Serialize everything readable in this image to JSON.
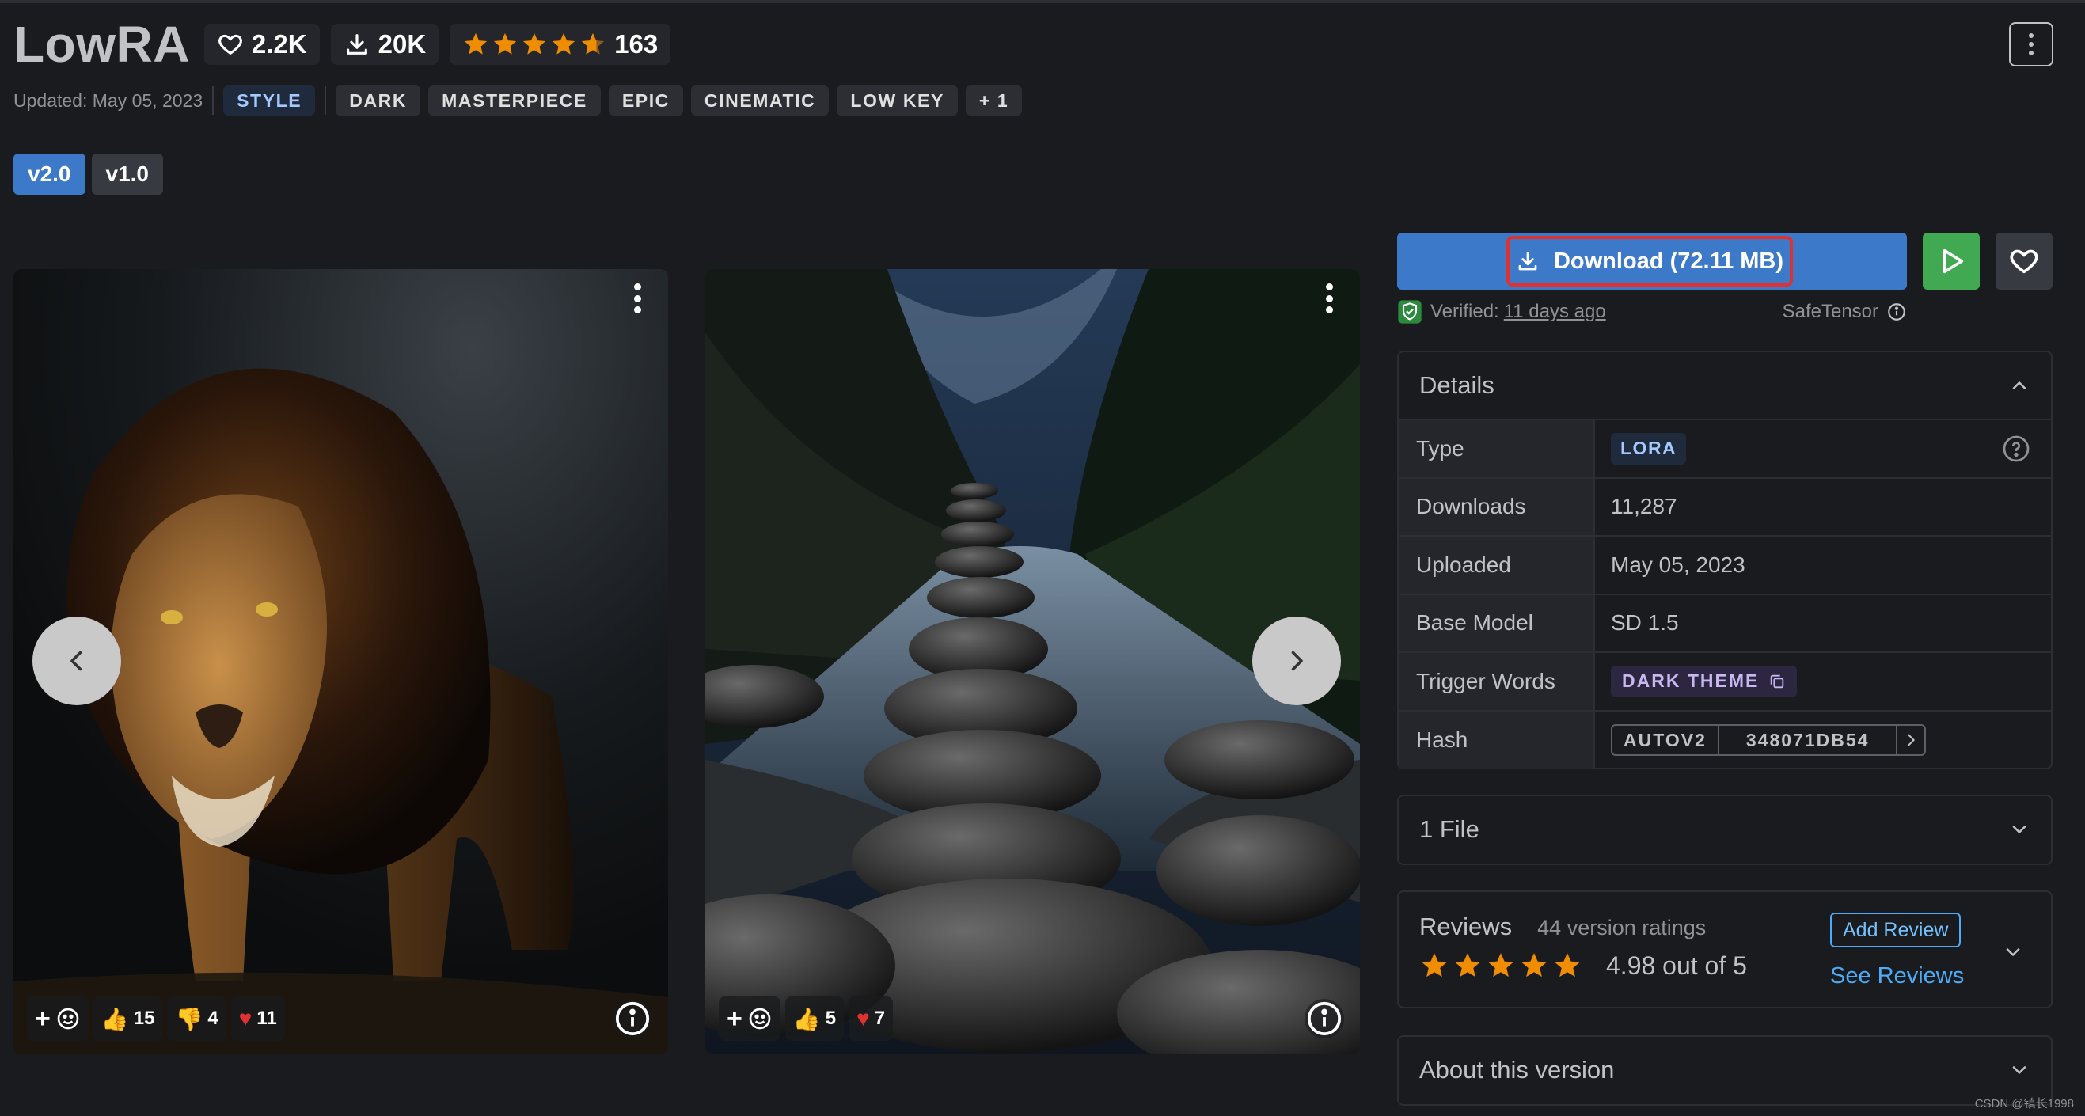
{
  "header": {
    "title": "LowRA",
    "likes": "2.2K",
    "downloads": "20K",
    "rating_count": "163"
  },
  "meta": {
    "updated": "Updated: May 05, 2023",
    "tags": [
      "STYLE",
      "DARK",
      "MASTERPIECE",
      "EPIC",
      "CINEMATIC",
      "LOW KEY",
      "+ 1"
    ]
  },
  "versions": [
    "v2.0",
    "v1.0"
  ],
  "gallery": {
    "image1": {
      "thumbs_up": "15",
      "thumbs_down": "4",
      "hearts": "11"
    },
    "image2": {
      "thumbs_up": "5",
      "hearts": "7"
    }
  },
  "actions": {
    "download_label": "Download (72.11 MB)",
    "verified_label": "Verified:",
    "verified_link": "11 days ago",
    "safetensor": "SafeTensor"
  },
  "details": {
    "title": "Details",
    "rows": [
      {
        "key": "Type",
        "value": "LORA"
      },
      {
        "key": "Downloads",
        "value": "11,287"
      },
      {
        "key": "Uploaded",
        "value": "May 05, 2023"
      },
      {
        "key": "Base Model",
        "value": "SD 1.5"
      },
      {
        "key": "Trigger Words",
        "value": "DARK THEME"
      },
      {
        "key": "Hash",
        "value": "348071DB54",
        "hash_type": "AUTOV2"
      }
    ]
  },
  "files": {
    "title": "1 File"
  },
  "reviews": {
    "title": "Reviews",
    "count": "44 version ratings",
    "score": "4.98 out of 5",
    "add_review": "Add Review",
    "see_reviews": "See Reviews"
  },
  "about": {
    "title": "About this version"
  },
  "watermark": "CSDN @镇长1998",
  "colors": {
    "background": "#1a1b1e",
    "primary": "#3d79c9",
    "play": "#40a951",
    "star": "#f08c00",
    "highlight": "#e03131"
  },
  "icons": [
    "heart-icon",
    "download-icon",
    "star-icon",
    "kebab-icon",
    "chevron-left-icon",
    "chevron-right-icon",
    "play-icon",
    "shield-check-icon",
    "info-icon",
    "help-icon",
    "copy-icon",
    "chevron-up-icon",
    "chevron-down-icon",
    "plus-icon",
    "smiley-icon"
  ]
}
